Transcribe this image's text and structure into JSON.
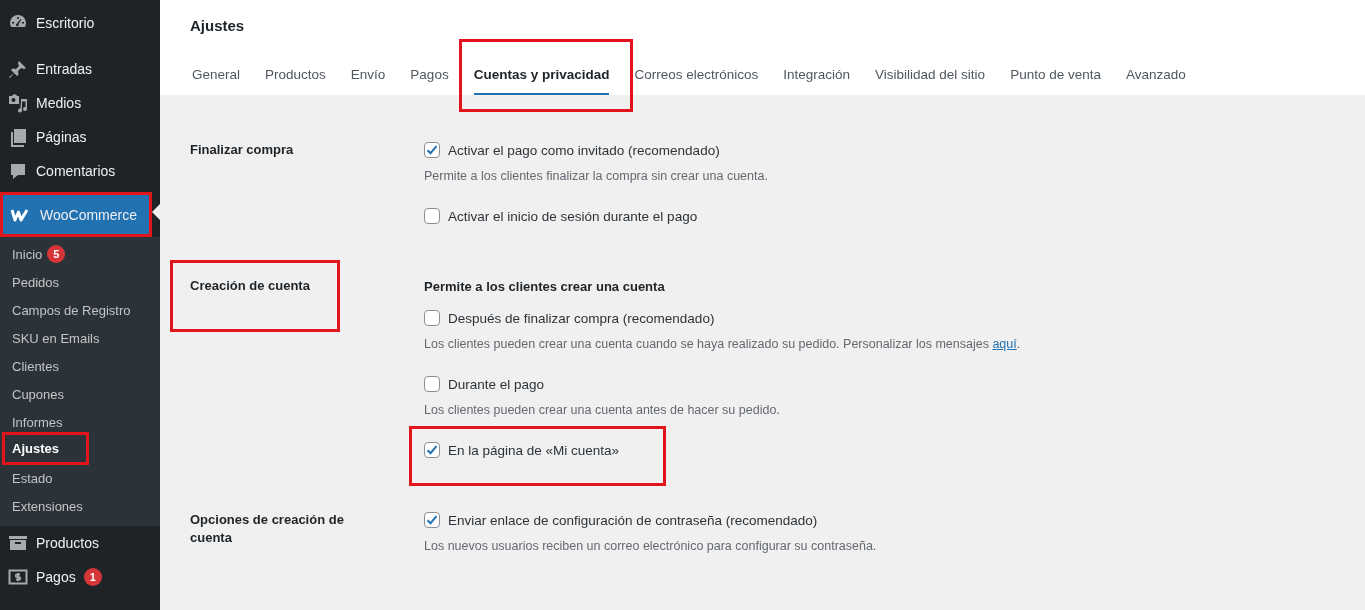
{
  "sidebar": {
    "menu": [
      {
        "label": "Escritorio",
        "selected": false,
        "highlighted": false
      },
      {
        "label": "Entradas",
        "selected": false,
        "highlighted": false
      },
      {
        "label": "Medios",
        "selected": false,
        "highlighted": false
      },
      {
        "label": "Páginas",
        "selected": false,
        "highlighted": false
      },
      {
        "label": "Comentarios",
        "selected": false,
        "highlighted": false
      },
      {
        "label": "WooCommerce",
        "selected": true,
        "highlighted": true,
        "submenu": [
          {
            "label": "Inicio",
            "badge": "5",
            "selected": false,
            "highlighted": false
          },
          {
            "label": "Pedidos",
            "selected": false,
            "highlighted": false
          },
          {
            "label": "Campos de Registro",
            "selected": false,
            "highlighted": false
          },
          {
            "label": "SKU en Emails",
            "selected": false,
            "highlighted": false
          },
          {
            "label": "Clientes",
            "selected": false,
            "highlighted": false
          },
          {
            "label": "Cupones",
            "selected": false,
            "highlighted": false
          },
          {
            "label": "Informes",
            "selected": false,
            "highlighted": false
          },
          {
            "label": "Ajustes",
            "selected": true,
            "highlighted": true
          },
          {
            "label": "Estado",
            "selected": false,
            "highlighted": false
          },
          {
            "label": "Extensiones",
            "selected": false,
            "highlighted": false
          }
        ]
      },
      {
        "label": "Productos",
        "selected": false,
        "highlighted": false
      },
      {
        "label": "Pagos",
        "badge": "1",
        "selected": false,
        "highlighted": false
      }
    ]
  },
  "page": {
    "title": "Ajustes",
    "tabs": [
      {
        "label": "General",
        "selected": false,
        "highlighted": false
      },
      {
        "label": "Productos",
        "selected": false,
        "highlighted": false
      },
      {
        "label": "Envío",
        "selected": false,
        "highlighted": false
      },
      {
        "label": "Pagos",
        "selected": false,
        "highlighted": false
      },
      {
        "label": "Cuentas y privacidad",
        "selected": true,
        "highlighted": true
      },
      {
        "label": "Correos electrónicos",
        "selected": false,
        "highlighted": false
      },
      {
        "label": "Integración",
        "selected": false,
        "highlighted": false
      },
      {
        "label": "Visibilidad del sitio",
        "selected": false,
        "highlighted": false
      },
      {
        "label": "Punto de venta",
        "selected": false,
        "highlighted": false
      },
      {
        "label": "Avanzado",
        "selected": false,
        "highlighted": false
      }
    ],
    "sections": [
      {
        "label": "Finalizar compra",
        "highlighted": false,
        "items": [
          {
            "kind": "checkbox",
            "label": "Activar el pago como invitado (recomendado)",
            "checked": true,
            "highlighted": false
          },
          {
            "kind": "description",
            "text": "Permite a los clientes finalizar la compra sin crear una cuenta."
          },
          {
            "kind": "checkbox",
            "label": "Activar el inicio de sesión durante el pago",
            "checked": false,
            "highlighted": false
          }
        ]
      },
      {
        "label": "Creación de cuenta",
        "highlighted": true,
        "items": [
          {
            "kind": "heading",
            "text": "Permite a los clientes crear una cuenta"
          },
          {
            "kind": "checkbox",
            "label": "Después de finalizar compra (recomendado)",
            "checked": false,
            "highlighted": false
          },
          {
            "kind": "description",
            "text": "Los clientes pueden crear una cuenta cuando se haya realizado su pedido. Personalizar los mensajes ",
            "link": "aquí",
            "suffix": "."
          },
          {
            "kind": "checkbox",
            "label": "Durante el pago",
            "checked": false,
            "highlighted": false
          },
          {
            "kind": "description",
            "text": "Los clientes pueden crear una cuenta antes de hacer su pedido."
          },
          {
            "kind": "checkbox",
            "label": "En la página de «Mi cuenta»",
            "checked": true,
            "highlighted": true
          }
        ]
      },
      {
        "label": "Opciones de creación de cuenta",
        "highlighted": false,
        "items": [
          {
            "kind": "checkbox",
            "label": "Enviar enlace de configuración de contraseña (recomendado)",
            "checked": true,
            "highlighted": false
          },
          {
            "kind": "description",
            "text": "Los nuevos usuarios reciben un correo electrónico para configurar su contraseña."
          }
        ]
      }
    ]
  }
}
